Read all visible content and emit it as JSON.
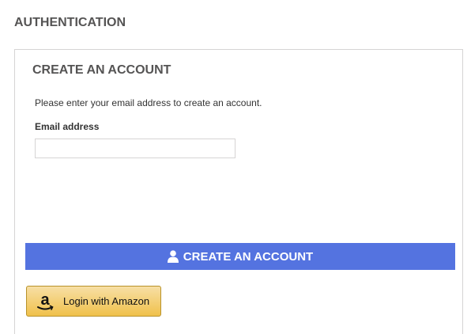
{
  "page": {
    "heading": "AUTHENTICATION"
  },
  "create_account": {
    "title": "CREATE AN ACCOUNT",
    "intro": "Please enter your email address to create an account.",
    "email_label": "Email address",
    "email_value": "",
    "email_placeholder": "",
    "submit_label": "CREATE AN ACCOUNT",
    "submit_icon": "user-icon",
    "amazon_label": "Login with Amazon",
    "amazon_icon": "amazon-logo-icon"
  },
  "colors": {
    "primary_button": "#5473e0",
    "amazon_button": "#f0c14b",
    "heading_text": "#555454",
    "border": "#d6d4d4"
  }
}
